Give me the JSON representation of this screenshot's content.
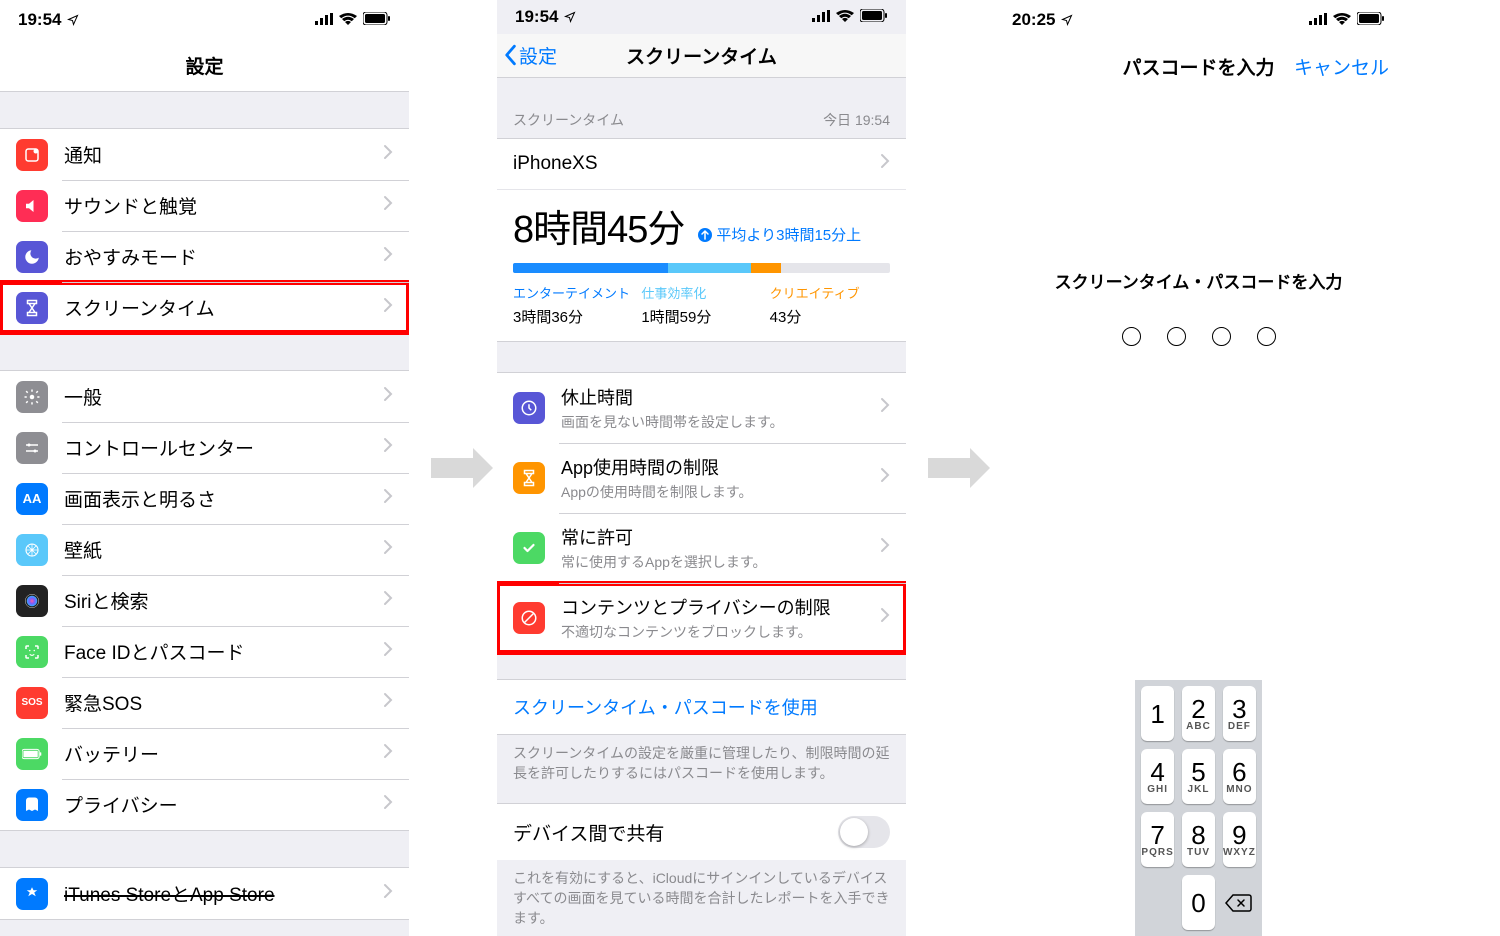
{
  "screen1": {
    "time": "19:54",
    "title": "設定",
    "groups": [
      [
        {
          "label": "通知",
          "icon_bg": "#ff3b30",
          "icon_name": "notifications-icon"
        },
        {
          "label": "サウンドと触覚",
          "icon_bg": "#ff2d55",
          "icon_name": "sounds-icon"
        },
        {
          "label": "おやすみモード",
          "icon_bg": "#5856d6",
          "icon_name": "dnd-icon"
        },
        {
          "label": "スクリーンタイム",
          "icon_bg": "#5856d6",
          "icon_name": "screentime-icon",
          "highlight": true
        }
      ],
      [
        {
          "label": "一般",
          "icon_bg": "#8e8e93",
          "icon_name": "general-icon"
        },
        {
          "label": "コントロールセンター",
          "icon_bg": "#8e8e93",
          "icon_name": "control-center-icon"
        },
        {
          "label": "画面表示と明るさ",
          "icon_bg": "#007aff",
          "icon_name": "display-icon",
          "icon_text": "AA"
        },
        {
          "label": "壁紙",
          "icon_bg": "#5ac8fa",
          "icon_name": "wallpaper-icon"
        },
        {
          "label": "Siriと検索",
          "icon_bg": "#222",
          "icon_name": "siri-icon"
        },
        {
          "label": "Face IDとパスコード",
          "icon_bg": "#4cd964",
          "icon_name": "faceid-icon"
        },
        {
          "label": "緊急SOS",
          "icon_bg": "#ff3b30",
          "icon_name": "sos-icon",
          "icon_text": "SOS"
        },
        {
          "label": "バッテリー",
          "icon_bg": "#4cd964",
          "icon_name": "battery-icon"
        },
        {
          "label": "プライバシー",
          "icon_bg": "#007aff",
          "icon_name": "privacy-icon"
        }
      ],
      [
        {
          "label": "iTunes StoreとApp Store",
          "icon_bg": "#007aff",
          "icon_name": "appstore-icon",
          "strike": true
        }
      ]
    ]
  },
  "screen2": {
    "time": "19:54",
    "back": "設定",
    "title": "スクリーンタイム",
    "section_label": "スクリーンタイム",
    "timestamp": "今日 19:54",
    "device": "iPhoneXS",
    "total": "8時間45分",
    "delta": "平均より3時間15分上",
    "cats": [
      {
        "name": "エンターテイメント",
        "val": "3時間36分"
      },
      {
        "name": "仕事効率化",
        "val": "1時間59分"
      },
      {
        "name": "クリエイティブ",
        "val": "43分"
      }
    ],
    "options": [
      {
        "t1": "休止時間",
        "t2": "画面を見ない時間帯を設定します。",
        "icon_bg": "#5856d6",
        "icon_name": "downtime-icon"
      },
      {
        "t1": "App使用時間の制限",
        "t2": "Appの使用時間を制限します。",
        "icon_bg": "#ff9500",
        "icon_name": "app-limits-icon"
      },
      {
        "t1": "常に許可",
        "t2": "常に使用するAppを選択します。",
        "icon_bg": "#4cd964",
        "icon_name": "always-allowed-icon"
      },
      {
        "t1": "コンテンツとプライバシーの制限",
        "t2": "不適切なコンテンツをブロックします。",
        "icon_bg": "#ff3b30",
        "icon_name": "content-privacy-icon",
        "highlight": true
      }
    ],
    "passcode_link": "スクリーンタイム・パスコードを使用",
    "passcode_note": "スクリーンタイムの設定を厳重に管理したり、制限時間の延長を許可したりするにはパスコードを使用します。",
    "share_label": "デバイス間で共有",
    "share_note": "これを有効にすると、iCloudにサインインしているデバイスすべての画面を見ている時間を合計したレポートを入手できます。"
  },
  "screen3": {
    "time": "20:25",
    "title": "パスコードを入力",
    "cancel": "キャンセル",
    "prompt": "スクリーンタイム・パスコードを入力",
    "keys": [
      {
        "n": "1",
        "l": ""
      },
      {
        "n": "2",
        "l": "ABC"
      },
      {
        "n": "3",
        "l": "DEF"
      },
      {
        "n": "4",
        "l": "GHI"
      },
      {
        "n": "5",
        "l": "JKL"
      },
      {
        "n": "6",
        "l": "MNO"
      },
      {
        "n": "7",
        "l": "PQRS"
      },
      {
        "n": "8",
        "l": "TUV"
      },
      {
        "n": "9",
        "l": "WXYZ"
      },
      {
        "n": "0",
        "l": ""
      }
    ]
  }
}
